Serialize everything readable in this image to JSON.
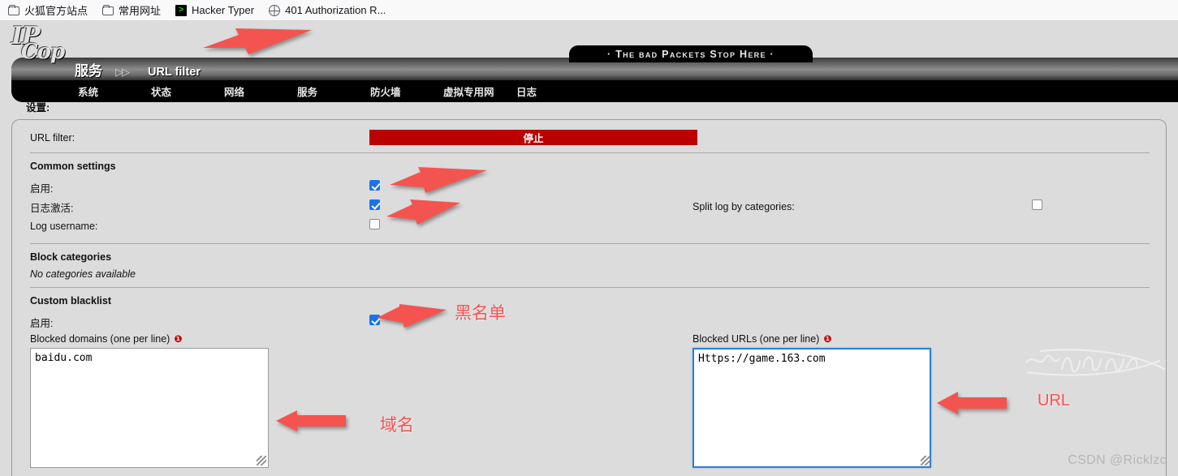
{
  "browser": {
    "bookmarks": [
      {
        "icon": "folder-icon",
        "label": "火狐官方站点"
      },
      {
        "icon": "folder-icon",
        "label": "常用网址"
      },
      {
        "icon": "hacker-typer-icon",
        "label": "Hacker Typer"
      },
      {
        "icon": "globe-icon",
        "label": "401 Authorization R..."
      }
    ]
  },
  "header": {
    "banner_tag": "· The bad Packets Stop Here ·",
    "logo_top": "IP",
    "logo_bottom": "Cop",
    "breadcrumb_section": "服务",
    "breadcrumb_arrow": "▷▷",
    "breadcrumb_page": "URL filter",
    "nav": [
      {
        "label": "系统"
      },
      {
        "label": "状态"
      },
      {
        "label": "网络"
      },
      {
        "label": "服务"
      },
      {
        "label": "防火墙"
      },
      {
        "label": "虚拟专用网"
      },
      {
        "label": "日志"
      }
    ]
  },
  "main": {
    "settings_title": "设置:",
    "url_filter_label": "URL filter:",
    "url_filter_status": "停止",
    "url_filter_status_color": "#bc0000",
    "common_settings": {
      "heading": "Common settings",
      "enable_label": "启用:",
      "enable_checked": true,
      "log_enabled_label": "日志激活:",
      "log_enabled_checked": true,
      "log_username_label": "Log username:",
      "log_username_checked": false,
      "split_log_label": "Split log by categories:",
      "split_log_checked": false
    },
    "block_categories": {
      "heading": "Block categories",
      "empty_text": "No categories available"
    },
    "custom_blacklist": {
      "heading": "Custom blacklist",
      "enable_label": "启用:",
      "enable_checked": true,
      "domains_label": "Blocked domains (one per line)",
      "domains_required_mark": "❶",
      "domains_value": "baidu.com",
      "urls_label": "Blocked URLs (one per line)",
      "urls_required_mark": "❶",
      "urls_value": "Https://game.163.com"
    }
  },
  "annotations": {
    "color": "#fa5050",
    "blacklist_note": "黑名单",
    "domain_note": "域名",
    "url_note": "URL"
  },
  "watermark": {
    "csdn": "CSDN @Ricklzc"
  }
}
